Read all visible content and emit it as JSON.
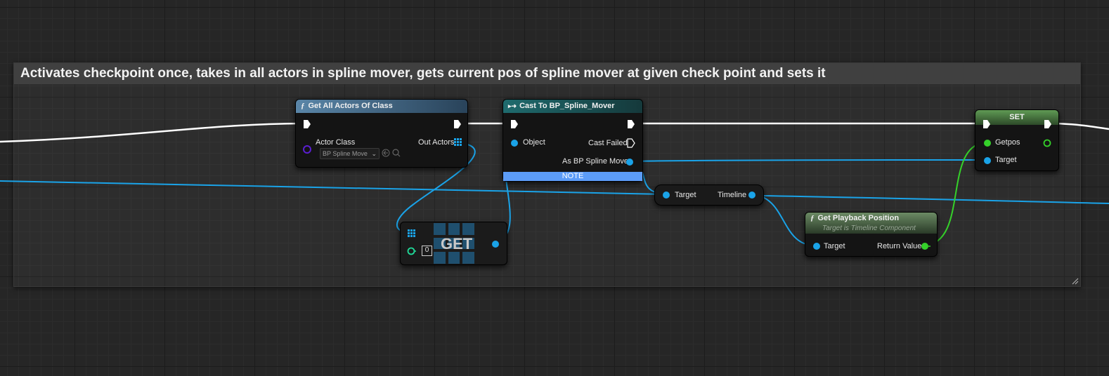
{
  "comment": {
    "title": "Activates checkpoint once, takes in all actors in spline mover, gets current pos of spline mover at given check point and sets it"
  },
  "nodes": {
    "get_all_actors": {
      "title": "Get All Actors Of Class",
      "actor_class_label": "Actor Class",
      "actor_class_value": "BP Spline Move",
      "out_actors_label": "Out Actors"
    },
    "cast": {
      "title": "Cast To BP_Spline_Mover",
      "object_label": "Object",
      "cast_failed_label": "Cast Failed",
      "as_label": "As BP Spline Mover",
      "note": "NOTE"
    },
    "get_array": {
      "title": "GET",
      "index_value": "0"
    },
    "timeline_getter": {
      "target_label": "Target",
      "timeline_label": "Timeline"
    },
    "playback": {
      "title": "Get Playback Position",
      "subtitle": "Target is Timeline Component",
      "target_label": "Target",
      "return_label": "Return Value"
    },
    "set": {
      "title": "SET",
      "getpos_label": "Getpos",
      "target_label": "Target"
    }
  },
  "colors": {
    "exec_wire": "#ffffff",
    "object_pin": "#1aa3e8",
    "float_pin": "#35d12a",
    "int_pin": "#1fdc9a",
    "class_pin": "#5a1fd1"
  }
}
